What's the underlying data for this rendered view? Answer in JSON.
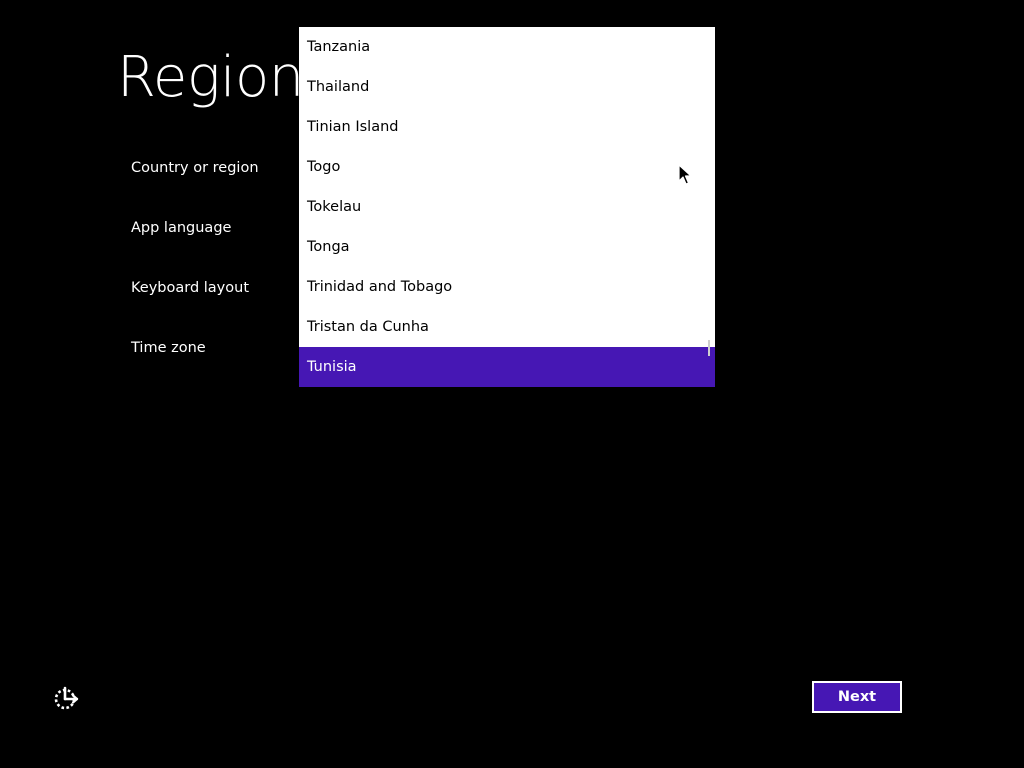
{
  "page": {
    "title": "Region"
  },
  "fields": {
    "country_label": "Country or region",
    "app_language_label": "App language",
    "keyboard_layout_label": "Keyboard layout",
    "time_zone_label": "Time zone"
  },
  "country_dropdown": {
    "options": [
      "Tanzania",
      "Thailand",
      "Tinian Island",
      "Togo",
      "Tokelau",
      "Tonga",
      "Trinidad and Tobago",
      "Tristan da Cunha",
      "Tunisia"
    ],
    "selected": "Tunisia"
  },
  "footer": {
    "next_label": "Next",
    "accessibility_icon": "ease-of-access-icon"
  },
  "colors": {
    "background": "#000000",
    "accent": "#4617b4",
    "dropdown_background": "#ffffff",
    "text_light": "#ffffff",
    "text_dark": "#000000"
  }
}
